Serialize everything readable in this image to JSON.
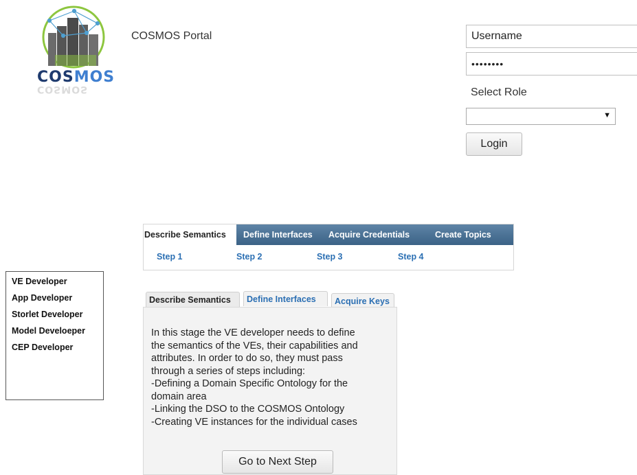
{
  "header": {
    "logo_text_a": "COS",
    "logo_text_b": "MOS",
    "portal_title": "COSMOS Portal"
  },
  "login": {
    "username_value": "Username",
    "password_value": "••••••••",
    "role_label": "Select Role",
    "role_selected": "",
    "login_label": "Login"
  },
  "wizard": {
    "tabs": [
      {
        "label": "Describe Semantics",
        "active": true
      },
      {
        "label": "Define Interfaces",
        "active": false
      },
      {
        "label": "Acquire Credentials",
        "active": false
      },
      {
        "label": "Create Topics",
        "active": false
      }
    ],
    "steps": [
      "Step 1",
      "Step 2",
      "Step 3",
      "Step 4"
    ]
  },
  "roles": [
    "VE Developer",
    "App Developer",
    "Storlet Developer",
    "Model Develoeper",
    "CEP Developer"
  ],
  "content_tabs": [
    {
      "label": "Describe Semantics",
      "active": true
    },
    {
      "label": "Define Interfaces",
      "active": false
    },
    {
      "label": "Acquire Keys",
      "active": false
    }
  ],
  "panel": {
    "lines": [
      "In this stage the VE developer needs to define",
      "the semantics of the VEs, their capabilities and",
      "attributes. In order to do so, they must pass",
      "through a series of steps including:",
      "-Defining a Domain Specific Ontology for the",
      "domain area",
      "-Linking the DSO to the COSMOS Ontology",
      "-Creating VE instances for the individual cases"
    ],
    "next_label": "Go to Next Step"
  },
  "colors": {
    "tab_bar": "#3b6286",
    "link_blue": "#2b6fb3",
    "logo_green": "#8dc63f",
    "logo_dark_blue": "#1e3a6e"
  }
}
